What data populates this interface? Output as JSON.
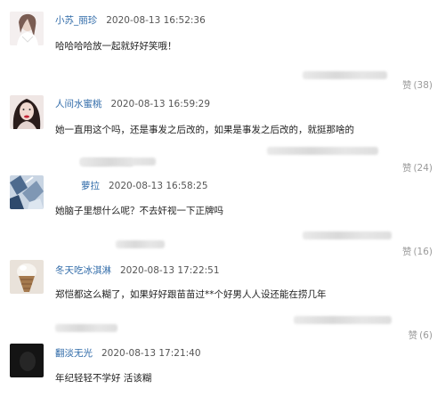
{
  "comments": [
    {
      "user": "小苏_丽珍",
      "time": "2020-08-13 16:52:36",
      "text": "哈哈哈哈放一起就好好笑哦！",
      "like_label": "赞",
      "like_count": "(38)",
      "avatar": "avatar-girl-light"
    },
    {
      "user": "人间水蜜桃",
      "time": "2020-08-13 16:59:29",
      "text": "她一直用这个吗，还是事发之后改的，如果是事发之后改的，就挺那啥的",
      "like_label": "赞",
      "like_count": "(24)",
      "avatar": "avatar-woman-red-lips"
    },
    {
      "user": "萝拉",
      "time": "2020-08-13 16:58:25",
      "text": "她脑子里想什么呢？不去奸视一下正牌吗",
      "like_label": "赞",
      "like_count": "(16)",
      "avatar": "avatar-blue-pattern"
    },
    {
      "user": "冬天吃冰淇淋",
      "time": "2020-08-13 17:22:51",
      "text": "郑恺都这么糊了，如果好好跟苗苗过**个好男人人设还能在捞几年",
      "like_label": "赞",
      "like_count": "(6)",
      "avatar": "avatar-ice-cream"
    },
    {
      "user": "翻淡无光",
      "time": "2020-08-13 17:21:40",
      "text": "年纪轻轻不学好 活该糊",
      "like_label": "赞",
      "like_count": "(4)",
      "avatar": "avatar-dark"
    }
  ],
  "colors": {
    "username": "#2f6aa8",
    "timestamp": "#555555",
    "like": "#9a9a9a",
    "divider": "#eeeeee"
  }
}
